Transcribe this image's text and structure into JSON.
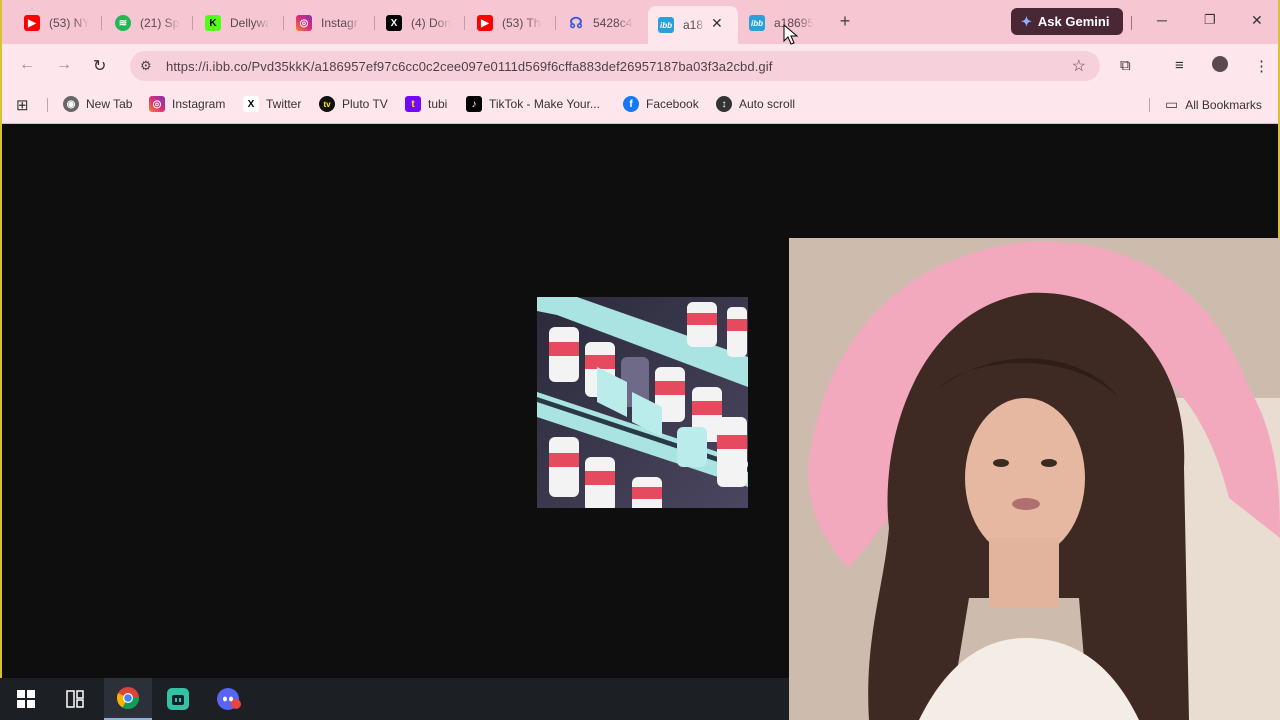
{
  "tabs": [
    {
      "label": "(53) NY",
      "icon": "youtube-icon",
      "color": "#ff0000"
    },
    {
      "label": "(21) Sp",
      "icon": "spotify-icon",
      "color": "#1db954"
    },
    {
      "label": "Dellywa",
      "icon": "k-logo-icon",
      "color": "#53fc18"
    },
    {
      "label": "Instagr",
      "icon": "instagram-icon",
      "color": "#e1306c"
    },
    {
      "label": "(4) Don",
      "icon": "x-logo-icon",
      "color": "#000000"
    },
    {
      "label": "(53) Th",
      "icon": "youtube-icon",
      "color": "#ff0000"
    },
    {
      "label": "5428c4",
      "icon": "headset-icon",
      "color": "#3b5bdb"
    },
    {
      "label": "a18",
      "icon": "ibb-icon",
      "color": "#2b9fd8"
    },
    {
      "label": "a18695",
      "icon": "ibb-icon",
      "color": "#2b9fd8"
    }
  ],
  "gemini": {
    "label": "Ask Gemini"
  },
  "address": {
    "url": "https://i.ibb.co/Pvd35kkK/a186957ef97c6cc0c2cee097e0111d569f6cffa883def26957187ba03f3a2cbd.gif"
  },
  "bookmarks": [
    {
      "label": "New Tab",
      "icon": "chrome-icon",
      "color": "#555555"
    },
    {
      "label": "Instagram",
      "icon": "instagram-icon",
      "color": "#e1306c"
    },
    {
      "label": "Twitter",
      "icon": "x-logo-icon",
      "color": "#000000"
    },
    {
      "label": "Pluto TV",
      "icon": "pluto-tv-icon",
      "color": "#111111"
    },
    {
      "label": "tubi",
      "icon": "tubi-icon",
      "color": "#7408ff"
    },
    {
      "label": "TikTok - Make Your...",
      "icon": "tiktok-icon",
      "color": "#000000"
    },
    {
      "label": "Facebook",
      "icon": "facebook-icon",
      "color": "#1877f2"
    },
    {
      "label": "Auto scroll",
      "icon": "auto-scroll-icon",
      "color": "#333333"
    }
  ],
  "all_bookmarks": {
    "label": "All Bookmarks"
  },
  "colors": {
    "tabstrip": "#f7c6d3",
    "toolbar": "#fde7ec",
    "omnibox": "#f6d1db",
    "gemini": "#4a2735"
  }
}
